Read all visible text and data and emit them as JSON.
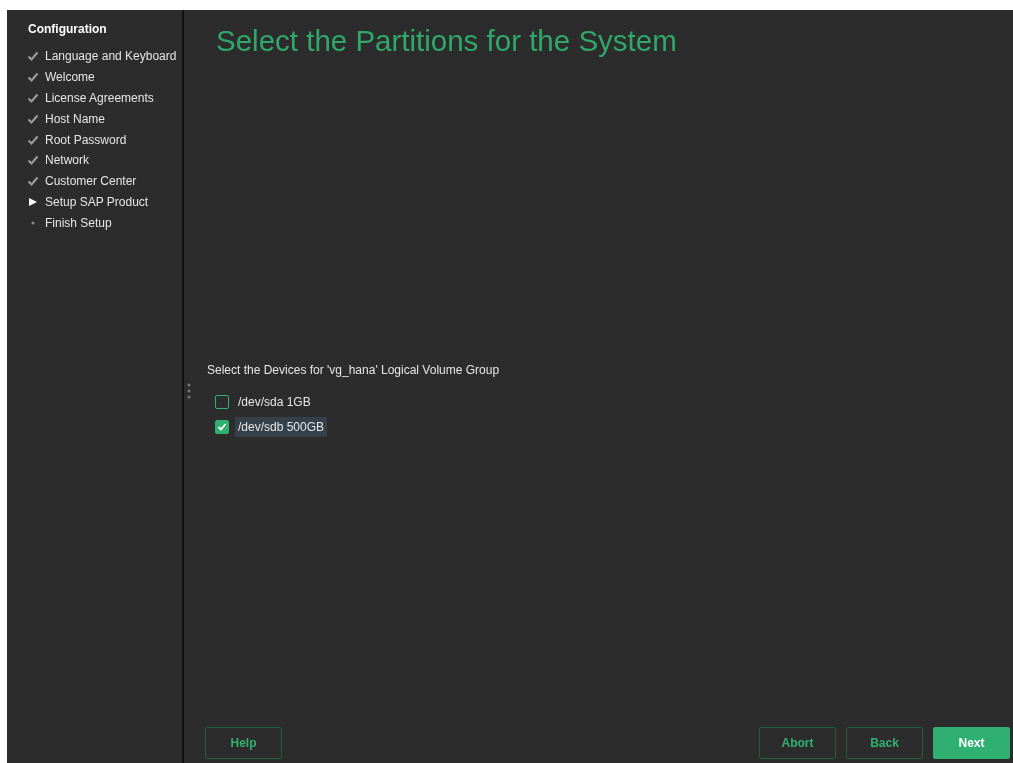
{
  "sidebar": {
    "title": "Configuration",
    "steps": [
      {
        "label": "Language and Keyboard",
        "kind": "done"
      },
      {
        "label": "Welcome",
        "kind": "done"
      },
      {
        "label": "License Agreements",
        "kind": "done"
      },
      {
        "label": "Host Name",
        "kind": "done"
      },
      {
        "label": "Root Password",
        "kind": "done"
      },
      {
        "label": "Network",
        "kind": "done"
      },
      {
        "label": "Customer Center",
        "kind": "done"
      },
      {
        "label": "Setup SAP Product",
        "kind": "current"
      },
      {
        "label": "Finish Setup",
        "kind": "pending"
      }
    ]
  },
  "page": {
    "title": "Select the Partitions for the System",
    "group_label": "Select the Devices for 'vg_hana' Logical Volume Group",
    "devices": [
      {
        "label": "/dev/sda 1GB",
        "checked": false,
        "selected": false
      },
      {
        "label": "/dev/sdb 500GB",
        "checked": true,
        "selected": true
      }
    ]
  },
  "left_buttons": [
    {
      "label": "Help",
      "kind": "outline"
    }
  ],
  "right_buttons": [
    {
      "label": "Abort",
      "kind": "outline"
    },
    {
      "label": "Back",
      "kind": "outline"
    },
    {
      "label": "Next",
      "kind": "primary"
    }
  ]
}
